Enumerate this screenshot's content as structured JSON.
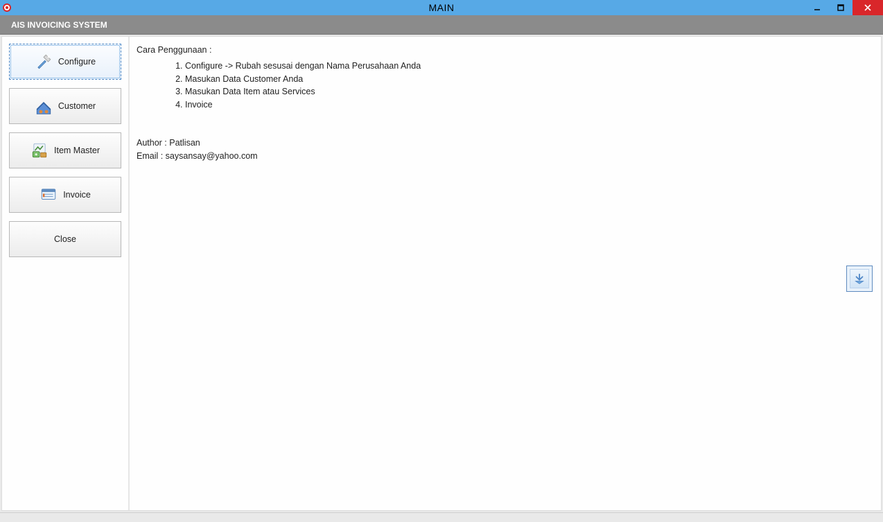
{
  "window": {
    "title": "MAIN"
  },
  "subheader": {
    "title": "AIS INVOICING SYSTEM"
  },
  "sidebar": {
    "buttons": {
      "configure": "Configure",
      "customer": "Customer",
      "item_master": "Item Master",
      "invoice": "Invoice",
      "close": "Close"
    }
  },
  "content": {
    "heading": "Cara Penggunaan :",
    "steps": [
      "Configure -> Rubah sesusai dengan Nama Perusahaan Anda",
      "Masukan Data Customer Anda",
      "Masukan Data Item atau Services",
      "Invoice"
    ],
    "author_line": "Author : Patlisan",
    "email_line": "Email : saysansay@yahoo.com"
  }
}
